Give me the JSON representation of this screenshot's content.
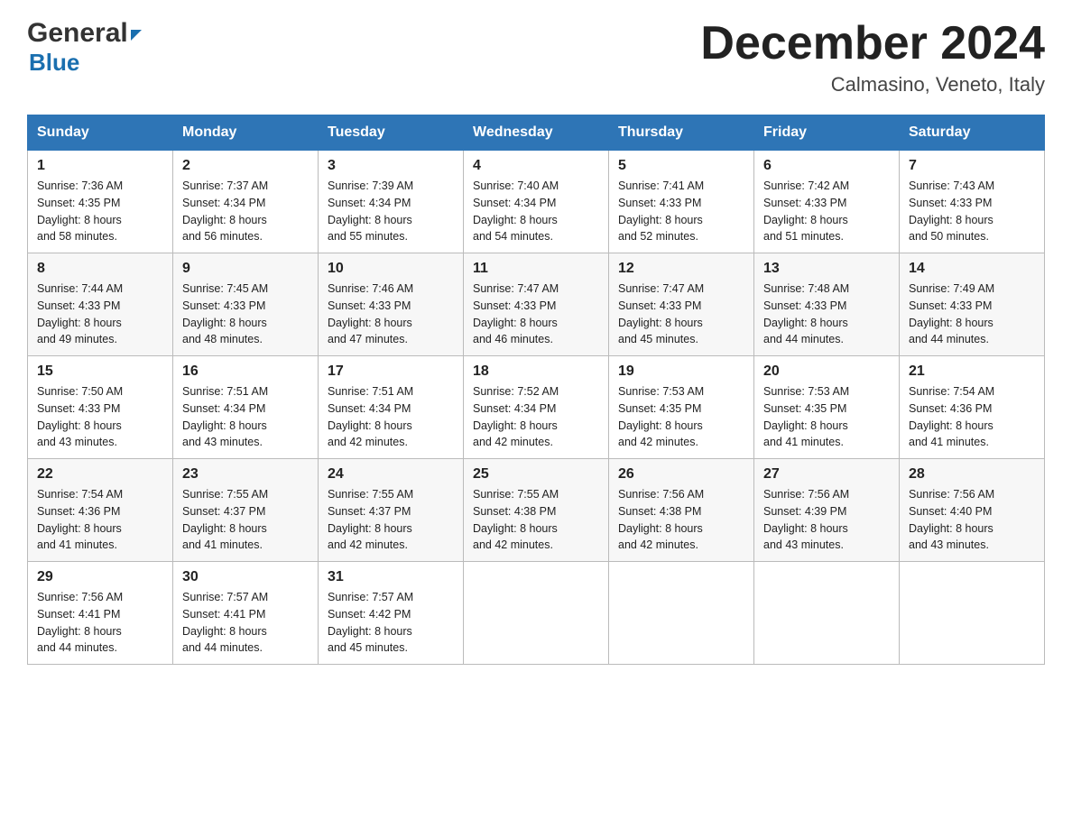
{
  "header": {
    "logo_general": "General",
    "logo_blue": "Blue",
    "month_title": "December 2024",
    "location": "Calmasino, Veneto, Italy"
  },
  "days_of_week": [
    "Sunday",
    "Monday",
    "Tuesday",
    "Wednesday",
    "Thursday",
    "Friday",
    "Saturday"
  ],
  "weeks": [
    [
      {
        "day": "1",
        "sunrise": "7:36 AM",
        "sunset": "4:35 PM",
        "daylight": "8 hours and 58 minutes."
      },
      {
        "day": "2",
        "sunrise": "7:37 AM",
        "sunset": "4:34 PM",
        "daylight": "8 hours and 56 minutes."
      },
      {
        "day": "3",
        "sunrise": "7:39 AM",
        "sunset": "4:34 PM",
        "daylight": "8 hours and 55 minutes."
      },
      {
        "day": "4",
        "sunrise": "7:40 AM",
        "sunset": "4:34 PM",
        "daylight": "8 hours and 54 minutes."
      },
      {
        "day": "5",
        "sunrise": "7:41 AM",
        "sunset": "4:33 PM",
        "daylight": "8 hours and 52 minutes."
      },
      {
        "day": "6",
        "sunrise": "7:42 AM",
        "sunset": "4:33 PM",
        "daylight": "8 hours and 51 minutes."
      },
      {
        "day": "7",
        "sunrise": "7:43 AM",
        "sunset": "4:33 PM",
        "daylight": "8 hours and 50 minutes."
      }
    ],
    [
      {
        "day": "8",
        "sunrise": "7:44 AM",
        "sunset": "4:33 PM",
        "daylight": "8 hours and 49 minutes."
      },
      {
        "day": "9",
        "sunrise": "7:45 AM",
        "sunset": "4:33 PM",
        "daylight": "8 hours and 48 minutes."
      },
      {
        "day": "10",
        "sunrise": "7:46 AM",
        "sunset": "4:33 PM",
        "daylight": "8 hours and 47 minutes."
      },
      {
        "day": "11",
        "sunrise": "7:47 AM",
        "sunset": "4:33 PM",
        "daylight": "8 hours and 46 minutes."
      },
      {
        "day": "12",
        "sunrise": "7:47 AM",
        "sunset": "4:33 PM",
        "daylight": "8 hours and 45 minutes."
      },
      {
        "day": "13",
        "sunrise": "7:48 AM",
        "sunset": "4:33 PM",
        "daylight": "8 hours and 44 minutes."
      },
      {
        "day": "14",
        "sunrise": "7:49 AM",
        "sunset": "4:33 PM",
        "daylight": "8 hours and 44 minutes."
      }
    ],
    [
      {
        "day": "15",
        "sunrise": "7:50 AM",
        "sunset": "4:33 PM",
        "daylight": "8 hours and 43 minutes."
      },
      {
        "day": "16",
        "sunrise": "7:51 AM",
        "sunset": "4:34 PM",
        "daylight": "8 hours and 43 minutes."
      },
      {
        "day": "17",
        "sunrise": "7:51 AM",
        "sunset": "4:34 PM",
        "daylight": "8 hours and 42 minutes."
      },
      {
        "day": "18",
        "sunrise": "7:52 AM",
        "sunset": "4:34 PM",
        "daylight": "8 hours and 42 minutes."
      },
      {
        "day": "19",
        "sunrise": "7:53 AM",
        "sunset": "4:35 PM",
        "daylight": "8 hours and 42 minutes."
      },
      {
        "day": "20",
        "sunrise": "7:53 AM",
        "sunset": "4:35 PM",
        "daylight": "8 hours and 41 minutes."
      },
      {
        "day": "21",
        "sunrise": "7:54 AM",
        "sunset": "4:36 PM",
        "daylight": "8 hours and 41 minutes."
      }
    ],
    [
      {
        "day": "22",
        "sunrise": "7:54 AM",
        "sunset": "4:36 PM",
        "daylight": "8 hours and 41 minutes."
      },
      {
        "day": "23",
        "sunrise": "7:55 AM",
        "sunset": "4:37 PM",
        "daylight": "8 hours and 41 minutes."
      },
      {
        "day": "24",
        "sunrise": "7:55 AM",
        "sunset": "4:37 PM",
        "daylight": "8 hours and 42 minutes."
      },
      {
        "day": "25",
        "sunrise": "7:55 AM",
        "sunset": "4:38 PM",
        "daylight": "8 hours and 42 minutes."
      },
      {
        "day": "26",
        "sunrise": "7:56 AM",
        "sunset": "4:38 PM",
        "daylight": "8 hours and 42 minutes."
      },
      {
        "day": "27",
        "sunrise": "7:56 AM",
        "sunset": "4:39 PM",
        "daylight": "8 hours and 43 minutes."
      },
      {
        "day": "28",
        "sunrise": "7:56 AM",
        "sunset": "4:40 PM",
        "daylight": "8 hours and 43 minutes."
      }
    ],
    [
      {
        "day": "29",
        "sunrise": "7:56 AM",
        "sunset": "4:41 PM",
        "daylight": "8 hours and 44 minutes."
      },
      {
        "day": "30",
        "sunrise": "7:57 AM",
        "sunset": "4:41 PM",
        "daylight": "8 hours and 44 minutes."
      },
      {
        "day": "31",
        "sunrise": "7:57 AM",
        "sunset": "4:42 PM",
        "daylight": "8 hours and 45 minutes."
      },
      null,
      null,
      null,
      null
    ]
  ],
  "labels": {
    "sunrise": "Sunrise:",
    "sunset": "Sunset:",
    "daylight": "Daylight:"
  }
}
